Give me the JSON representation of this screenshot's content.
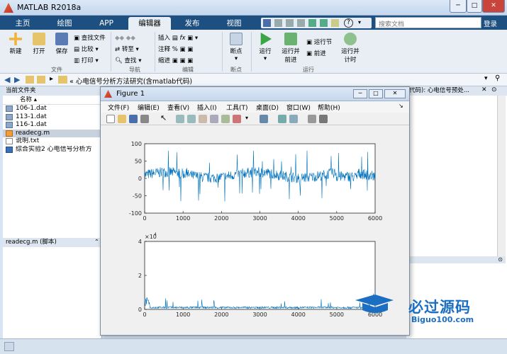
{
  "window": {
    "title": "MATLAB R2018a",
    "search_placeholder": "搜索文档",
    "login": "登录"
  },
  "tabs": [
    "主页",
    "绘图",
    "APP",
    "编辑器",
    "发布",
    "视图"
  ],
  "ribbon": {
    "file": {
      "new": "新建",
      "open": "打开",
      "save": "保存",
      "find_files": "查找文件",
      "compare": "比较",
      "print": "打印",
      "label": "文件"
    },
    "nav": {
      "goto": "转至",
      "find": "查找",
      "label": "导航"
    },
    "edit": {
      "insert": "插入",
      "comment": "注释",
      "indent": "缩进",
      "label": "编辑"
    },
    "breakpoints": {
      "btn": "断点",
      "label": "断点"
    },
    "run": {
      "run": "运行",
      "run_advance": "运行并\n前进",
      "run_section": "运行节",
      "advance": "前进",
      "run_time": "运行并\n计时",
      "label": "运行"
    }
  },
  "path": {
    "text": "«  心电信号分析方法研究(含matlab代码)"
  },
  "file_browser": {
    "header": "当前文件夹",
    "col": "名称",
    "files": [
      {
        "name": "106-1.dat",
        "selected": false
      },
      {
        "name": "113-1.dat",
        "selected": false
      },
      {
        "name": "116-1.dat",
        "selected": false
      },
      {
        "name": "readecg.m",
        "selected": true
      },
      {
        "name": "说明.txt",
        "selected": false
      },
      {
        "name": "综合实验2 心电信号分析方",
        "selected": false
      }
    ],
    "details": "readecg.m  (脚本)"
  },
  "editor_tab": "代码): 心电信号预处...",
  "figure": {
    "title": "Figure 1",
    "menu": [
      "文件(F)",
      "编辑(E)",
      "查看(V)",
      "插入(I)",
      "工具(T)",
      "桌面(D)",
      "窗口(W)",
      "帮助(H)"
    ]
  },
  "chart_data": [
    {
      "type": "line",
      "x_range": [
        0,
        6000
      ],
      "ylim": [
        -100,
        100
      ],
      "xticks": [
        "0",
        "1000",
        "2000",
        "3000",
        "4000",
        "5000",
        "6000"
      ],
      "yticks": [
        "100",
        "50",
        "0",
        "-50",
        "-100"
      ],
      "color": "#0072bd",
      "description_values": "noisy ECG signal around 10, range ~-70 to 80"
    },
    {
      "type": "line",
      "x_range": [
        0,
        6000
      ],
      "ylim": [
        0,
        4
      ],
      "y_multiplier": "× 10^4",
      "multiplier_text": "×10",
      "multiplier_exp": "4",
      "xticks": [
        "0",
        "1000",
        "2000",
        "3000",
        "4000",
        "5000",
        "6000"
      ],
      "yticks": [
        "4",
        "2",
        "0"
      ],
      "color": "#0072bd"
    }
  ],
  "watermark": {
    "title": "必过源码",
    "url": "Biguo100.com"
  }
}
